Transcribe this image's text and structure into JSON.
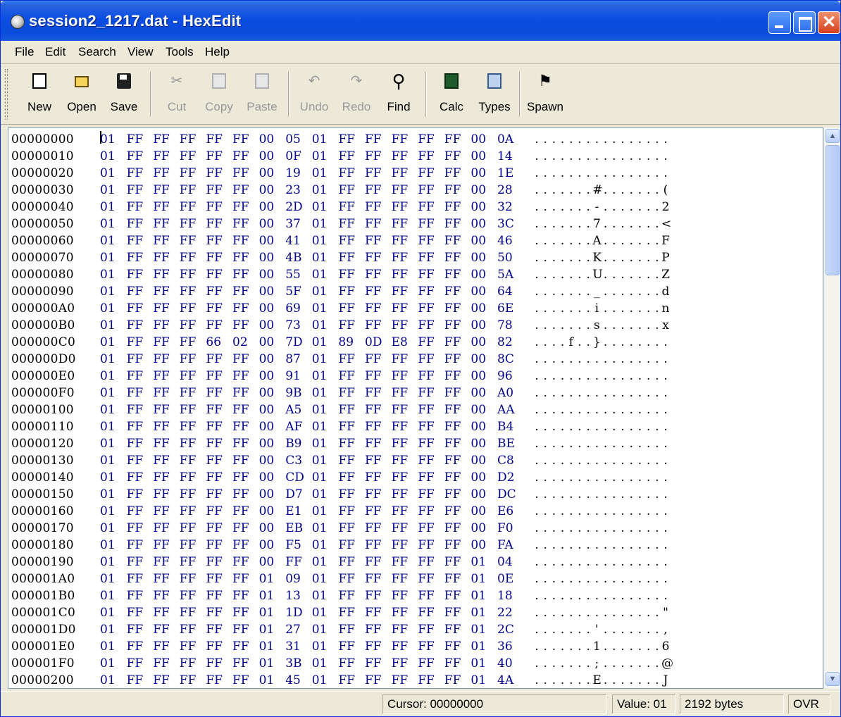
{
  "window": {
    "title": "session2_1217.dat - HexEdit"
  },
  "menu": [
    "File",
    "Edit",
    "Search",
    "View",
    "Tools",
    "Help"
  ],
  "toolbar": [
    {
      "label": "New",
      "icon": "new-file-icon",
      "enabled": true
    },
    {
      "label": "Open",
      "icon": "open-folder-icon",
      "enabled": true
    },
    {
      "label": "Save",
      "icon": "save-disk-icon",
      "enabled": true
    },
    {
      "label": "Cut",
      "icon": "scissors-icon",
      "enabled": false
    },
    {
      "label": "Copy",
      "icon": "copy-icon",
      "enabled": false
    },
    {
      "label": "Paste",
      "icon": "paste-icon",
      "enabled": false
    },
    {
      "label": "Undo",
      "icon": "undo-icon",
      "enabled": false
    },
    {
      "label": "Redo",
      "icon": "redo-icon",
      "enabled": false
    },
    {
      "label": "Find",
      "icon": "magnifier-icon",
      "enabled": true
    },
    {
      "label": "Calc",
      "icon": "calculator-icon",
      "enabled": true
    },
    {
      "label": "Types",
      "icon": "types-icon",
      "enabled": true
    },
    {
      "label": "Spawn",
      "icon": "spawn-icon",
      "enabled": true
    }
  ],
  "hex_rows": [
    {
      "addr": "00000000",
      "bytes": "01 FF FF FF FF FF 00 05 01 FF FF FF FF FF 00 0A",
      "ascii": "................"
    },
    {
      "addr": "00000010",
      "bytes": "01 FF FF FF FF FF 00 0F 01 FF FF FF FF FF 00 14",
      "ascii": "................"
    },
    {
      "addr": "00000020",
      "bytes": "01 FF FF FF FF FF 00 19 01 FF FF FF FF FF 00 1E",
      "ascii": "................"
    },
    {
      "addr": "00000030",
      "bytes": "01 FF FF FF FF FF 00 23 01 FF FF FF FF FF 00 28",
      "ascii": ".......#.......("
    },
    {
      "addr": "00000040",
      "bytes": "01 FF FF FF FF FF 00 2D 01 FF FF FF FF FF 00 32",
      "ascii": ".......-.......2"
    },
    {
      "addr": "00000050",
      "bytes": "01 FF FF FF FF FF 00 37 01 FF FF FF FF FF 00 3C",
      "ascii": ".......7.......<"
    },
    {
      "addr": "00000060",
      "bytes": "01 FF FF FF FF FF 00 41 01 FF FF FF FF FF 00 46",
      "ascii": ".......A.......F"
    },
    {
      "addr": "00000070",
      "bytes": "01 FF FF FF FF FF 00 4B 01 FF FF FF FF FF 00 50",
      "ascii": ".......K.......P"
    },
    {
      "addr": "00000080",
      "bytes": "01 FF FF FF FF FF 00 55 01 FF FF FF FF FF 00 5A",
      "ascii": ".......U.......Z"
    },
    {
      "addr": "00000090",
      "bytes": "01 FF FF FF FF FF 00 5F 01 FF FF FF FF FF 00 64",
      "ascii": "......._.......d"
    },
    {
      "addr": "000000A0",
      "bytes": "01 FF FF FF FF FF 00 69 01 FF FF FF FF FF 00 6E",
      "ascii": ".......i.......n"
    },
    {
      "addr": "000000B0",
      "bytes": "01 FF FF FF FF FF 00 73 01 FF FF FF FF FF 00 78",
      "ascii": ".......s.......x"
    },
    {
      "addr": "000000C0",
      "bytes": "01 FF FF FF 66 02 00 7D 01 89 0D E8 FF FF 00 82",
      "ascii": "....f..}........"
    },
    {
      "addr": "000000D0",
      "bytes": "01 FF FF FF FF FF 00 87 01 FF FF FF FF FF 00 8C",
      "ascii": "................"
    },
    {
      "addr": "000000E0",
      "bytes": "01 FF FF FF FF FF 00 91 01 FF FF FF FF FF 00 96",
      "ascii": "................"
    },
    {
      "addr": "000000F0",
      "bytes": "01 FF FF FF FF FF 00 9B 01 FF FF FF FF FF 00 A0",
      "ascii": "................"
    },
    {
      "addr": "00000100",
      "bytes": "01 FF FF FF FF FF 00 A5 01 FF FF FF FF FF 00 AA",
      "ascii": "................"
    },
    {
      "addr": "00000110",
      "bytes": "01 FF FF FF FF FF 00 AF 01 FF FF FF FF FF 00 B4",
      "ascii": "................"
    },
    {
      "addr": "00000120",
      "bytes": "01 FF FF FF FF FF 00 B9 01 FF FF FF FF FF 00 BE",
      "ascii": "................"
    },
    {
      "addr": "00000130",
      "bytes": "01 FF FF FF FF FF 00 C3 01 FF FF FF FF FF 00 C8",
      "ascii": "................"
    },
    {
      "addr": "00000140",
      "bytes": "01 FF FF FF FF FF 00 CD 01 FF FF FF FF FF 00 D2",
      "ascii": "................"
    },
    {
      "addr": "00000150",
      "bytes": "01 FF FF FF FF FF 00 D7 01 FF FF FF FF FF 00 DC",
      "ascii": "................"
    },
    {
      "addr": "00000160",
      "bytes": "01 FF FF FF FF FF 00 E1 01 FF FF FF FF FF 00 E6",
      "ascii": "................"
    },
    {
      "addr": "00000170",
      "bytes": "01 FF FF FF FF FF 00 EB 01 FF FF FF FF FF 00 F0",
      "ascii": "................"
    },
    {
      "addr": "00000180",
      "bytes": "01 FF FF FF FF FF 00 F5 01 FF FF FF FF FF 00 FA",
      "ascii": "................"
    },
    {
      "addr": "00000190",
      "bytes": "01 FF FF FF FF FF 00 FF 01 FF FF FF FF FF 01 04",
      "ascii": "................"
    },
    {
      "addr": "000001A0",
      "bytes": "01 FF FF FF FF FF 01 09 01 FF FF FF FF FF 01 0E",
      "ascii": "................"
    },
    {
      "addr": "000001B0",
      "bytes": "01 FF FF FF FF FF 01 13 01 FF FF FF FF FF 01 18",
      "ascii": "................"
    },
    {
      "addr": "000001C0",
      "bytes": "01 FF FF FF FF FF 01 1D 01 FF FF FF FF FF 01 22",
      "ascii": "...............\""
    },
    {
      "addr": "000001D0",
      "bytes": "01 FF FF FF FF FF 01 27 01 FF FF FF FF FF 01 2C",
      "ascii": ".......'.......,"
    },
    {
      "addr": "000001E0",
      "bytes": "01 FF FF FF FF FF 01 31 01 FF FF FF FF FF 01 36",
      "ascii": ".......1.......6"
    },
    {
      "addr": "000001F0",
      "bytes": "01 FF FF FF FF FF 01 3B 01 FF FF FF FF FF 01 40",
      "ascii": ".......;.......@"
    },
    {
      "addr": "00000200",
      "bytes": "01 FF FF FF FF FF 01 45 01 FF FF FF FF FF 01 4A",
      "ascii": ".......E.......J"
    }
  ],
  "status": {
    "cursor": "Cursor: 00000000",
    "value": "Value: 01",
    "size": "2192 bytes",
    "mode": "OVR"
  },
  "colors": {
    "hex_bytes": "#00008b",
    "titlebar": "#0b4ee2",
    "chrome": "#ece9d8"
  }
}
